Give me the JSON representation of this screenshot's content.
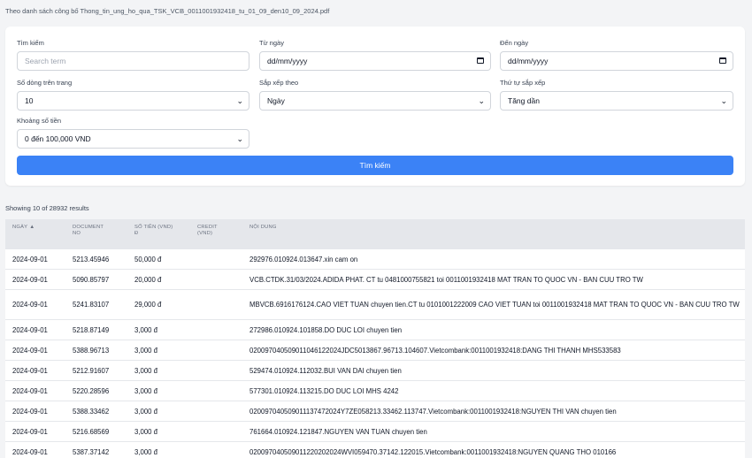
{
  "source_line": "Theo danh sách công bố Thong_tin_ung_ho_qua_TSK_VCB_0011001932418_tu_01_09_den10_09_2024.pdf",
  "filters": {
    "search": {
      "label": "Tìm kiếm",
      "placeholder": "Search term"
    },
    "from_date": {
      "label": "Từ ngày",
      "value": "dd/mm/yyyy",
      "icon": "calendar-icon"
    },
    "to_date": {
      "label": "Đến ngày",
      "value": "dd/mm/yyyy",
      "icon": "calendar-icon"
    },
    "rows_per_page": {
      "label": "Số dòng trên trang",
      "value": "10"
    },
    "sort_by": {
      "label": "Sắp xếp theo",
      "value": "Ngày"
    },
    "sort_order": {
      "label": "Thứ tự sắp xếp",
      "value": "Tăng dần"
    },
    "amount_range": {
      "label": "Khoảng số tiền",
      "value": "0 đến 100,000 VND"
    },
    "search_button": "Tìm kiếm"
  },
  "results": {
    "showing": "Showing 10 of 28932 results"
  },
  "table": {
    "headers": [
      {
        "line1": "NGÀY",
        "line2": "",
        "sort": "▲"
      },
      {
        "line1": "DOCUMENT",
        "line2": "NO",
        "sort": ""
      },
      {
        "line1": "SỐ TIỀN (VND)",
        "line2": "đ",
        "sort": ""
      },
      {
        "line1": "CREDIT",
        "line2": "(VND)",
        "sort": ""
      },
      {
        "line1": "NỘI DUNG",
        "line2": "",
        "sort": ""
      }
    ],
    "rows": [
      {
        "date": "2024-09-01",
        "doc": "5213.45946",
        "amount": "50,000 đ",
        "credit": "",
        "content": "292976.010924.013647.xin cam on"
      },
      {
        "date": "2024-09-01",
        "doc": "5090.85797",
        "amount": "20,000 đ",
        "credit": "",
        "content": "VCB.CTDK.31/03/2024.ADIDA PHAT. CT tu 0481000755821 toi 0011001932418 MAT TRAN TO QUOC VN - BAN CUU TRO TW"
      },
      {
        "date": "2024-09-01",
        "doc": "5241.83107",
        "amount": "29,000 đ",
        "credit": "",
        "content": "MBVCB.6916176124.CAO VIET TUAN chuyen tien.CT tu 0101001222009 CAO VIET TUAN toi 0011001932418 MAT TRAN TO QUOC VN - BAN CUU TRO TW"
      },
      {
        "date": "2024-09-01",
        "doc": "5218.87149",
        "amount": "3,000 đ",
        "credit": "",
        "content": "272986.010924.101858.DO DUC LOI chuyen tien"
      },
      {
        "date": "2024-09-01",
        "doc": "5388.96713",
        "amount": "3,000 đ",
        "credit": "",
        "content": "020097040509011046122024JDC5013867.96713.104607.Vietcombank:0011001932418:DANG THI THANH MHS533583"
      },
      {
        "date": "2024-09-01",
        "doc": "5212.91607",
        "amount": "3,000 đ",
        "credit": "",
        "content": "529474.010924.112032.BUI VAN DAI chuyen tien"
      },
      {
        "date": "2024-09-01",
        "doc": "5220.28596",
        "amount": "3,000 đ",
        "credit": "",
        "content": "577301.010924.113215.DO DUC LOI MHS 4242"
      },
      {
        "date": "2024-09-01",
        "doc": "5388.33462",
        "amount": "3,000 đ",
        "credit": "",
        "content": "020097040509011137472024Y7ZE058213.33462.113747.Vietcombank:0011001932418:NGUYEN THI VAN chuyen tien"
      },
      {
        "date": "2024-09-01",
        "doc": "5216.68569",
        "amount": "3,000 đ",
        "credit": "",
        "content": "761664.010924.121847.NGUYEN VAN TUAN chuyen tien"
      },
      {
        "date": "2024-09-01",
        "doc": "5387.37142",
        "amount": "3,000 đ",
        "credit": "",
        "content": "020097040509011220202024WVI059470.37142.122015.Vietcombank:0011001932418:NGUYEN QUANG THO 010166"
      }
    ]
  }
}
